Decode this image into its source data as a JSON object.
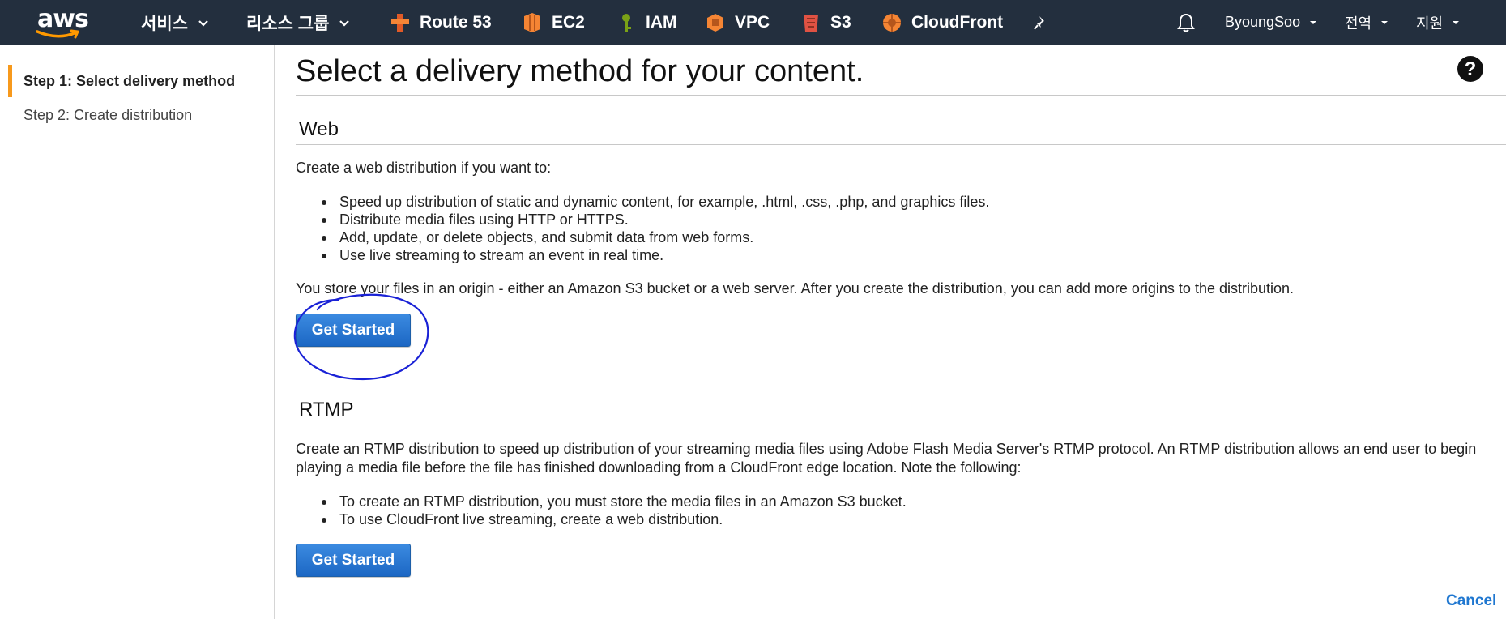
{
  "topnav": {
    "logo_text": "aws",
    "services_label": "서비스",
    "resource_groups_label": "리소스 그룹",
    "shortcuts": [
      {
        "label": "Route 53",
        "icon": "route53-icon",
        "color": "#e05a27"
      },
      {
        "label": "EC2",
        "icon": "ec2-icon",
        "color": "#f58534"
      },
      {
        "label": "IAM",
        "icon": "iam-icon",
        "color": "#7aa116"
      },
      {
        "label": "VPC",
        "icon": "vpc-icon",
        "color": "#f58534"
      },
      {
        "label": "S3",
        "icon": "s3-icon",
        "color": "#e05243"
      },
      {
        "label": "CloudFront",
        "icon": "cloudfront-icon",
        "color": "#f58534"
      }
    ],
    "pin_icon": "pin-icon",
    "bell_icon": "bell-icon",
    "account_label": "ByoungSoo",
    "region_label": "전역",
    "support_label": "지원",
    "background_color": "#232f3e"
  },
  "sidebar": {
    "items": [
      {
        "label": "Step 1: Select delivery method",
        "active": true
      },
      {
        "label": "Step 2: Create distribution",
        "active": false
      }
    ],
    "active_accent": "#f7991c"
  },
  "main": {
    "title": "Select a delivery method for your content.",
    "help_icon": "question-circle-icon",
    "web": {
      "heading": "Web",
      "intro": "Create a web distribution if you want to:",
      "bullets": [
        "Speed up distribution of static and dynamic content, for example, .html, .css, .php, and graphics files.",
        "Distribute media files using HTTP or HTTPS.",
        "Add, update, or delete objects, and submit data from web forms.",
        "Use live streaming to stream an event in real time."
      ],
      "note": "You store your files in an origin - either an Amazon S3 bucket or a web server. After you create the distribution, you can add more origins to the distribution.",
      "button_label": "Get Started"
    },
    "rtmp": {
      "heading": "RTMP",
      "intro": "Create an RTMP distribution to speed up distribution of your streaming media files using Adobe Flash Media Server's RTMP protocol. An RTMP distribution allows an end user to begin playing a media file before the file has finished downloading from a CloudFront edge location. Note the following:",
      "bullets": [
        "To create an RTMP distribution, you must store the media files in an Amazon S3 bucket.",
        "To use CloudFront live streaming, create a web distribution."
      ],
      "button_label": "Get Started"
    },
    "cancel_label": "Cancel",
    "button_color": "#2a78d6",
    "link_color": "#1f77d0",
    "annotation_color": "#1a22d6"
  }
}
